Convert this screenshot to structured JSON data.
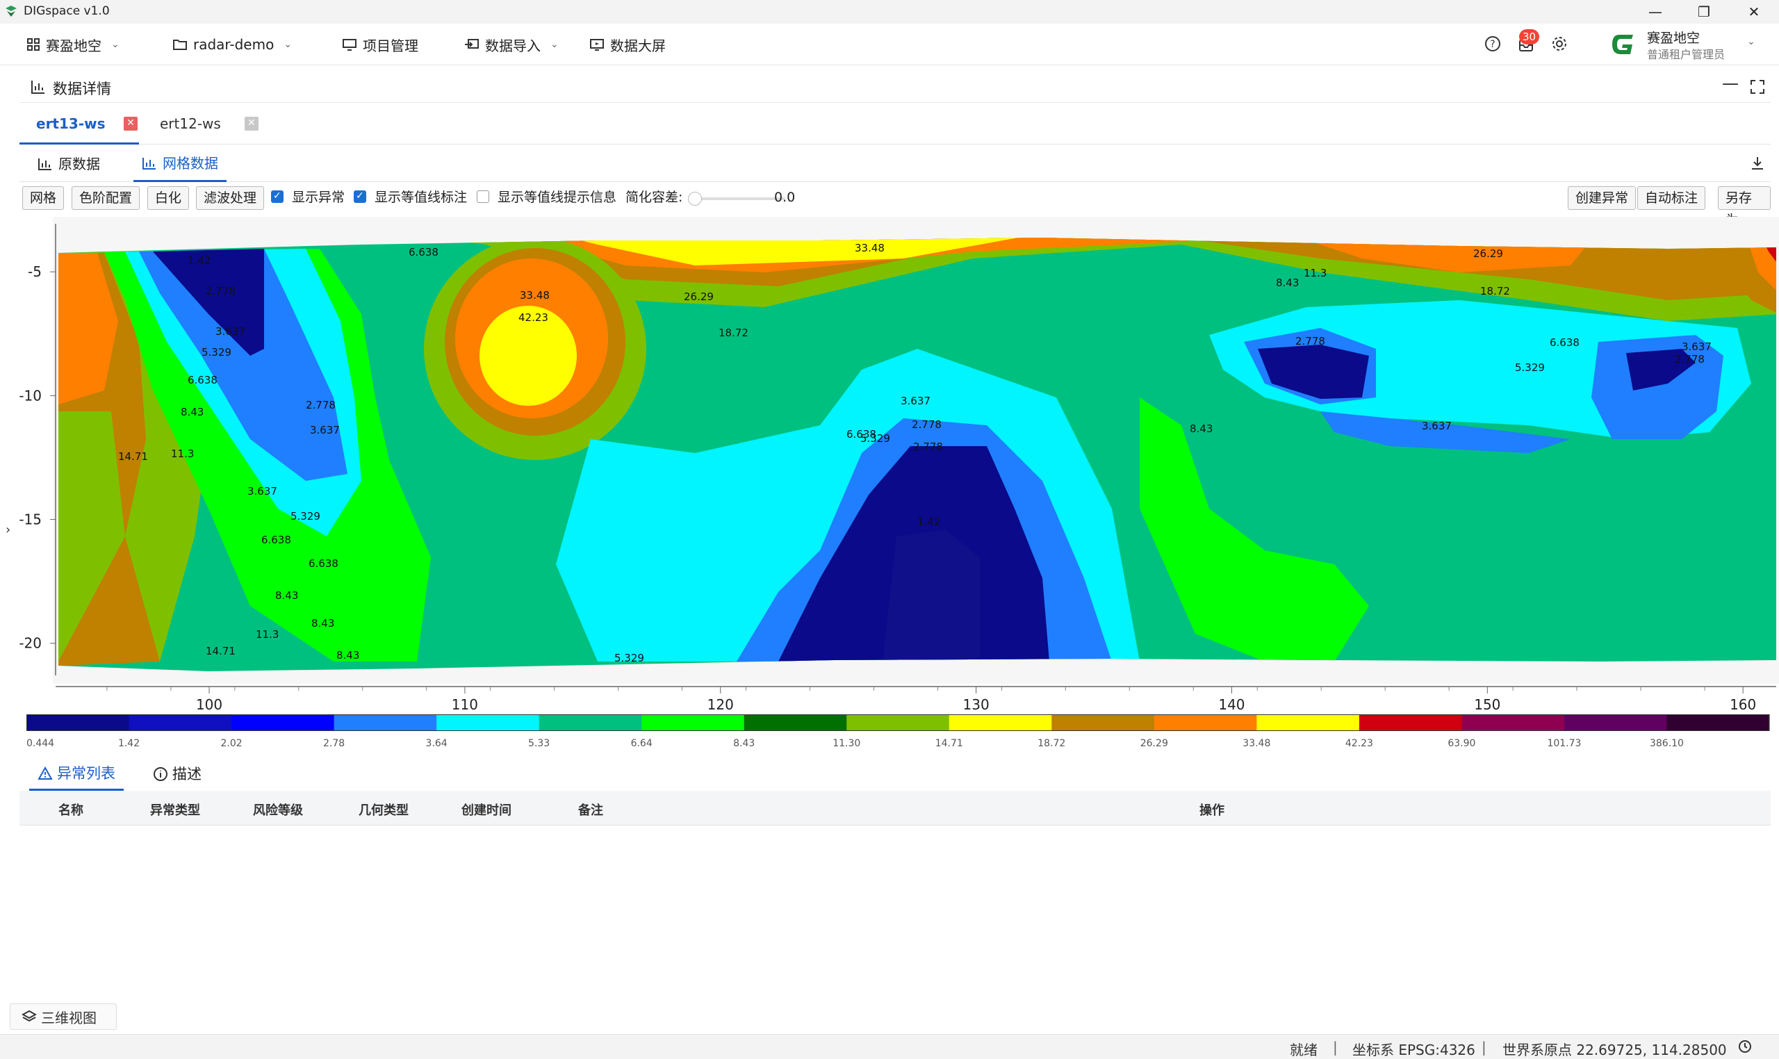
{
  "window": {
    "title": "DIGspace v1.0"
  },
  "menubar": {
    "workspace": "赛盈地空",
    "project": "radar-demo",
    "project_mgmt": "项目管理",
    "data_import": "数据导入",
    "data_screen": "数据大屏",
    "notif_count": "30",
    "user_name": "赛盈地空",
    "user_role": "普通租户管理员"
  },
  "panel": {
    "title": "数据详情"
  },
  "tabs": [
    {
      "label": "ert13-ws",
      "active": true
    },
    {
      "label": "ert12-ws",
      "active": false
    }
  ],
  "subtabs": [
    {
      "label": "原数据"
    },
    {
      "label": "网格数据"
    }
  ],
  "toolbar": {
    "grid": "网格",
    "color_config": "色阶配置",
    "whiten": "白化",
    "filter": "滤波处理",
    "show_anomaly": "显示异常",
    "show_contour_labels": "显示等值线标注",
    "show_contour_tips": "显示等值线提示信息",
    "simplify_label": "简化容差:",
    "simplify_value": "0.0",
    "create_anomaly": "创建异常",
    "auto_label": "自动标注",
    "save_as": "另存为"
  },
  "chart_data": {
    "type": "heatmap",
    "x_ticks": [
      100,
      110,
      120,
      130,
      140,
      150,
      160
    ],
    "y_ticks": [
      -5,
      -10,
      -15,
      -20
    ],
    "xlim": [
      94.1,
      161.3
    ],
    "ylim": [
      -21.3,
      -3.9
    ],
    "contour_labels": [
      "1.42",
      "2.778",
      "3.637",
      "5.329",
      "6.638",
      "8.43",
      "11.3",
      "14.71",
      "18.72",
      "26.29",
      "33.48",
      "42.23"
    ],
    "colorbar": {
      "ticks": [
        "0.444",
        "1.42",
        "2.02",
        "2.78",
        "3.64",
        "5.33",
        "6.64",
        "8.43",
        "11.30",
        "14.71",
        "18.72",
        "26.29",
        "33.48",
        "42.23",
        "63.90",
        "101.73",
        "386.10"
      ],
      "colors": [
        "#0a0a8a",
        "#1010c0",
        "#0000ff",
        "#1f7fff",
        "#00f5ff",
        "#00c080",
        "#00ff00",
        "#007000",
        "#7ec000",
        "#ffff00",
        "#c08000",
        "#ff7f00",
        "#ffff00",
        "#d00010",
        "#900050",
        "#600060",
        "#300030"
      ]
    }
  },
  "bottom": {
    "tab_anomaly": "异常列表",
    "tab_desc": "描述",
    "columns": [
      "名称",
      "异常类型",
      "风险等级",
      "几何类型",
      "创建时间",
      "备注",
      "操作"
    ]
  },
  "view3d": "三维视图",
  "status": {
    "ready": "就绪",
    "crs": "坐标系 EPSG:4326",
    "origin": "世界系原点  22.69725, 114.28500"
  }
}
